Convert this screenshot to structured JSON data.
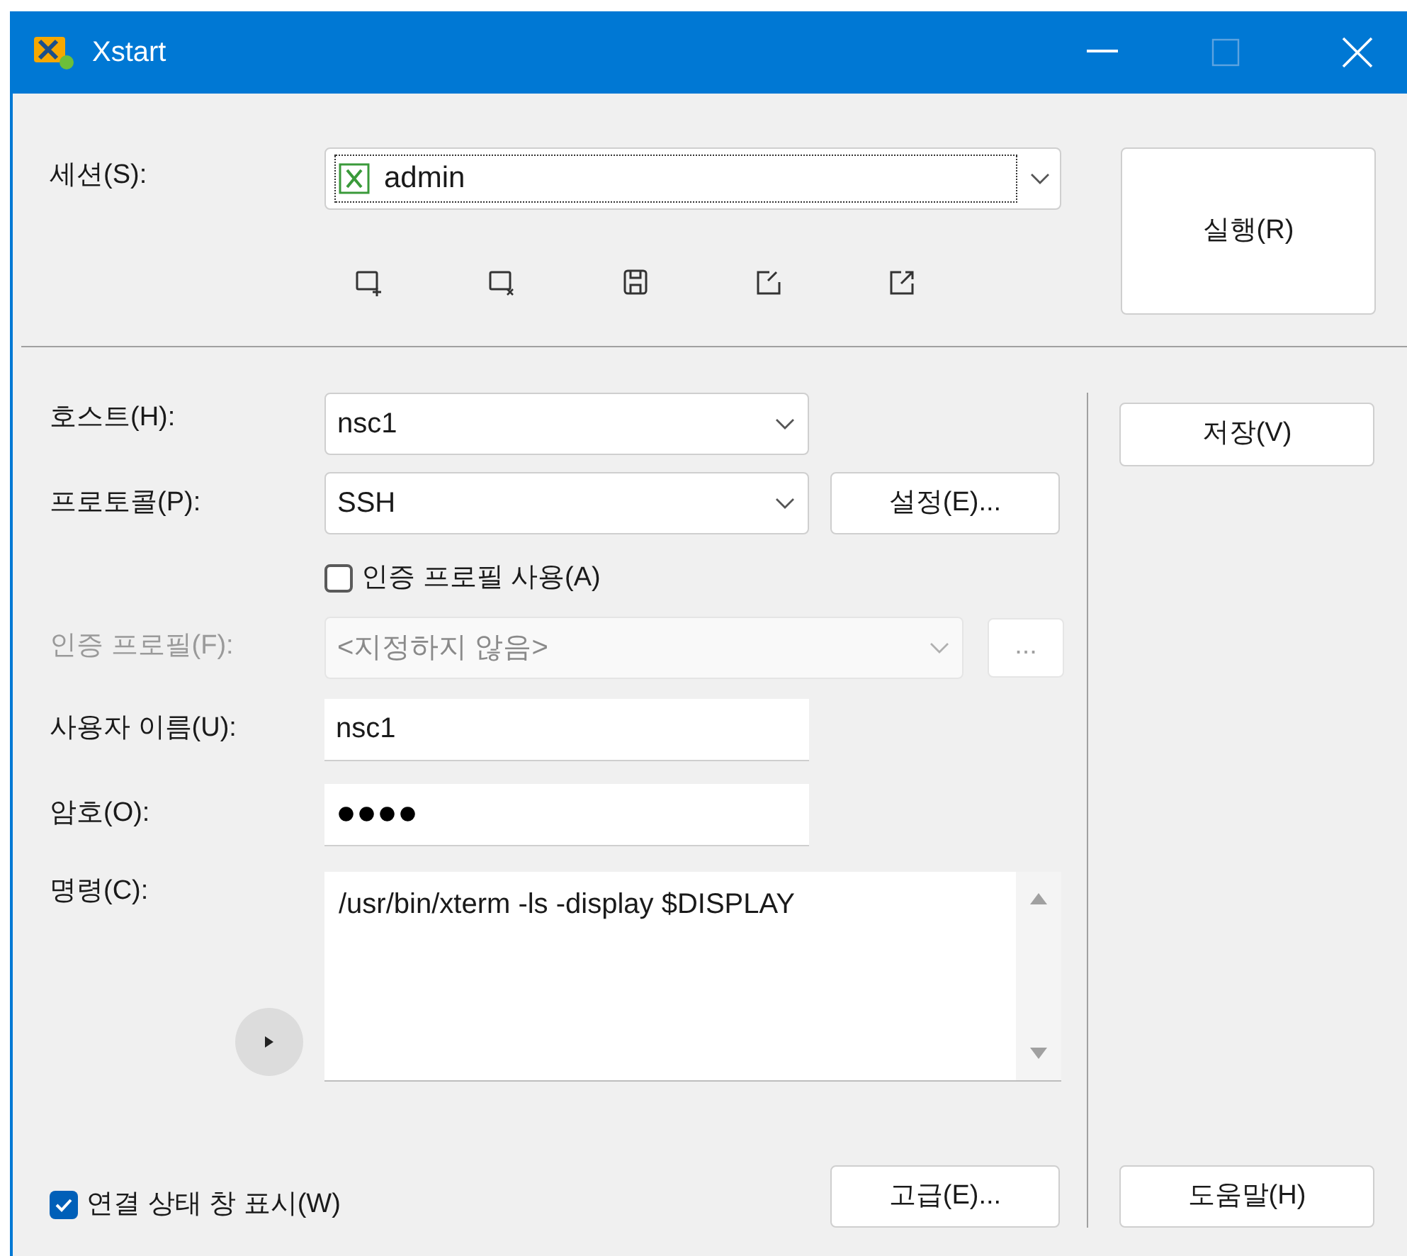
{
  "window": {
    "title": "Xstart"
  },
  "session": {
    "label": "세션(S):",
    "value": "admin"
  },
  "run_button": "실행(R)",
  "host": {
    "label": "호스트(H):",
    "value": "nsc1"
  },
  "protocol": {
    "label": "프로토콜(P):",
    "value": "SSH"
  },
  "settings_button": "설정(E)...",
  "use_auth_profile": {
    "label": "인증 프로필 사용(A)",
    "checked": false
  },
  "auth_profile": {
    "label": "인증 프로필(F):",
    "value": "<지정하지 않음>",
    "disabled": true
  },
  "browse_button": {
    "label": "...",
    "disabled": true
  },
  "username": {
    "label": "사용자 이름(U):",
    "value": "nsc1"
  },
  "password": {
    "label": "암호(O):",
    "value": "●●●●"
  },
  "command": {
    "label": "명령(C):",
    "value": "/usr/bin/xterm -ls -display $DISPLAY"
  },
  "save_button": "저장(V)",
  "show_status": {
    "label": "연결 상태 창 표시(W)",
    "checked": true
  },
  "advanced_button": "고급(E)...",
  "help_button": "도움말(H)"
}
